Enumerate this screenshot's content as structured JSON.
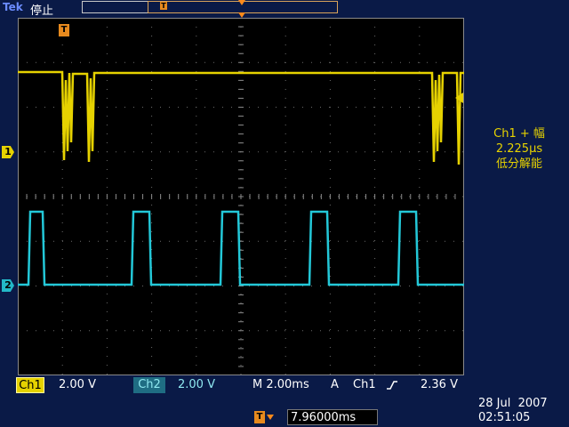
{
  "header": {
    "brand": "Tek",
    "status": "停止"
  },
  "markers": {
    "trigger_label": "T",
    "ch1_label": "1",
    "ch2_label": "2"
  },
  "measurement": {
    "line1": "Ch1 + 幅",
    "line2": "2.225µs",
    "line3": "低分解能"
  },
  "readout": {
    "ch1_label": "Ch1",
    "ch1_scale": "2.00 V",
    "ch2_label": "Ch2",
    "ch2_scale": "2.00 V",
    "timebase": "M 2.00ms",
    "trigger_mode": "A",
    "trigger_source": "Ch1",
    "trigger_slope_icon": "rising-edge-icon",
    "trigger_level": "2.36 V"
  },
  "delay": {
    "value": "7.96000ms"
  },
  "datetime": {
    "date": "28 Jul  2007",
    "time": "02:51:05"
  },
  "colors": {
    "ch1": "#e6d200",
    "ch2": "#23c8d8",
    "trigger": "#ff8a1a",
    "background": "#0a1a47"
  }
}
